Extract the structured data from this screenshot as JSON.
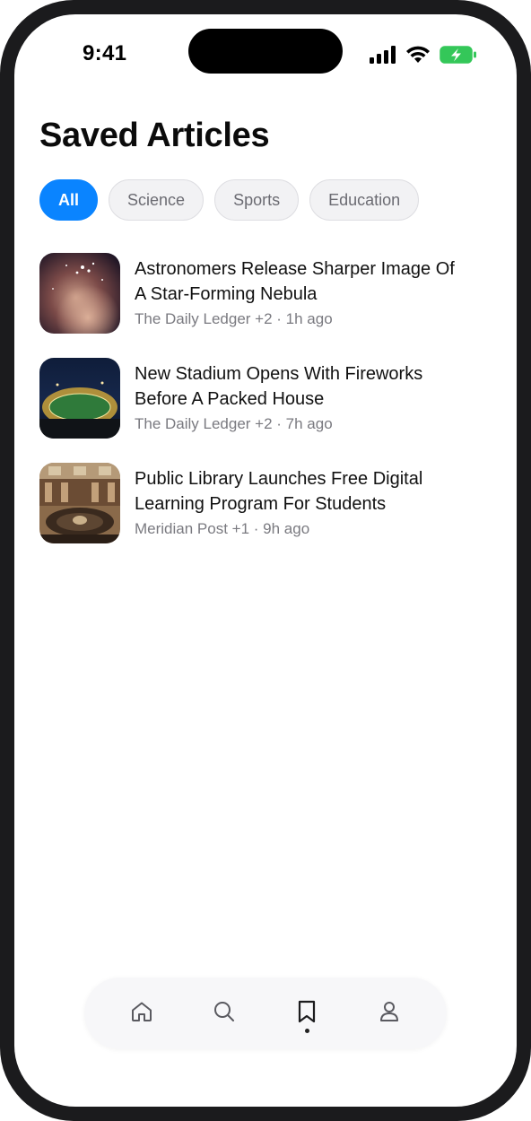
{
  "status_bar": {
    "time": "9:41",
    "icons": [
      "signal-icon",
      "wifi-icon",
      "battery-charging-icon"
    ],
    "battery_color": "#34c759"
  },
  "page": {
    "title": "Saved Articles"
  },
  "filters": {
    "active_color": "#0a84ff",
    "items": [
      {
        "label": "All",
        "active": true
      },
      {
        "label": "Science",
        "active": false
      },
      {
        "label": "Sports",
        "active": false
      },
      {
        "label": "Education",
        "active": false
      }
    ]
  },
  "articles": [
    {
      "title_line1": "Astronomers Release Sharper Image Of",
      "title_line2": "A Star-Forming Nebula",
      "meta": "The Daily Ledger +2 · 1h ago",
      "thumbnail": "nebula-image"
    },
    {
      "title_line1": "New Stadium Opens With Fireworks",
      "title_line2": "Before A Packed House",
      "meta": "The Daily Ledger +2 · 7h ago",
      "thumbnail": "stadium-image"
    },
    {
      "title_line1": "Public Library Launches Free Digital",
      "title_line2": "Learning Program For Students",
      "meta": "Meridian Post +1 · 9h ago",
      "thumbnail": "library-image"
    }
  ],
  "tab_bar": {
    "items": [
      {
        "icon": "home-icon",
        "active": false
      },
      {
        "icon": "search-icon",
        "active": false
      },
      {
        "icon": "bookmark-icon",
        "active": true
      },
      {
        "icon": "profile-icon",
        "active": false
      }
    ]
  }
}
